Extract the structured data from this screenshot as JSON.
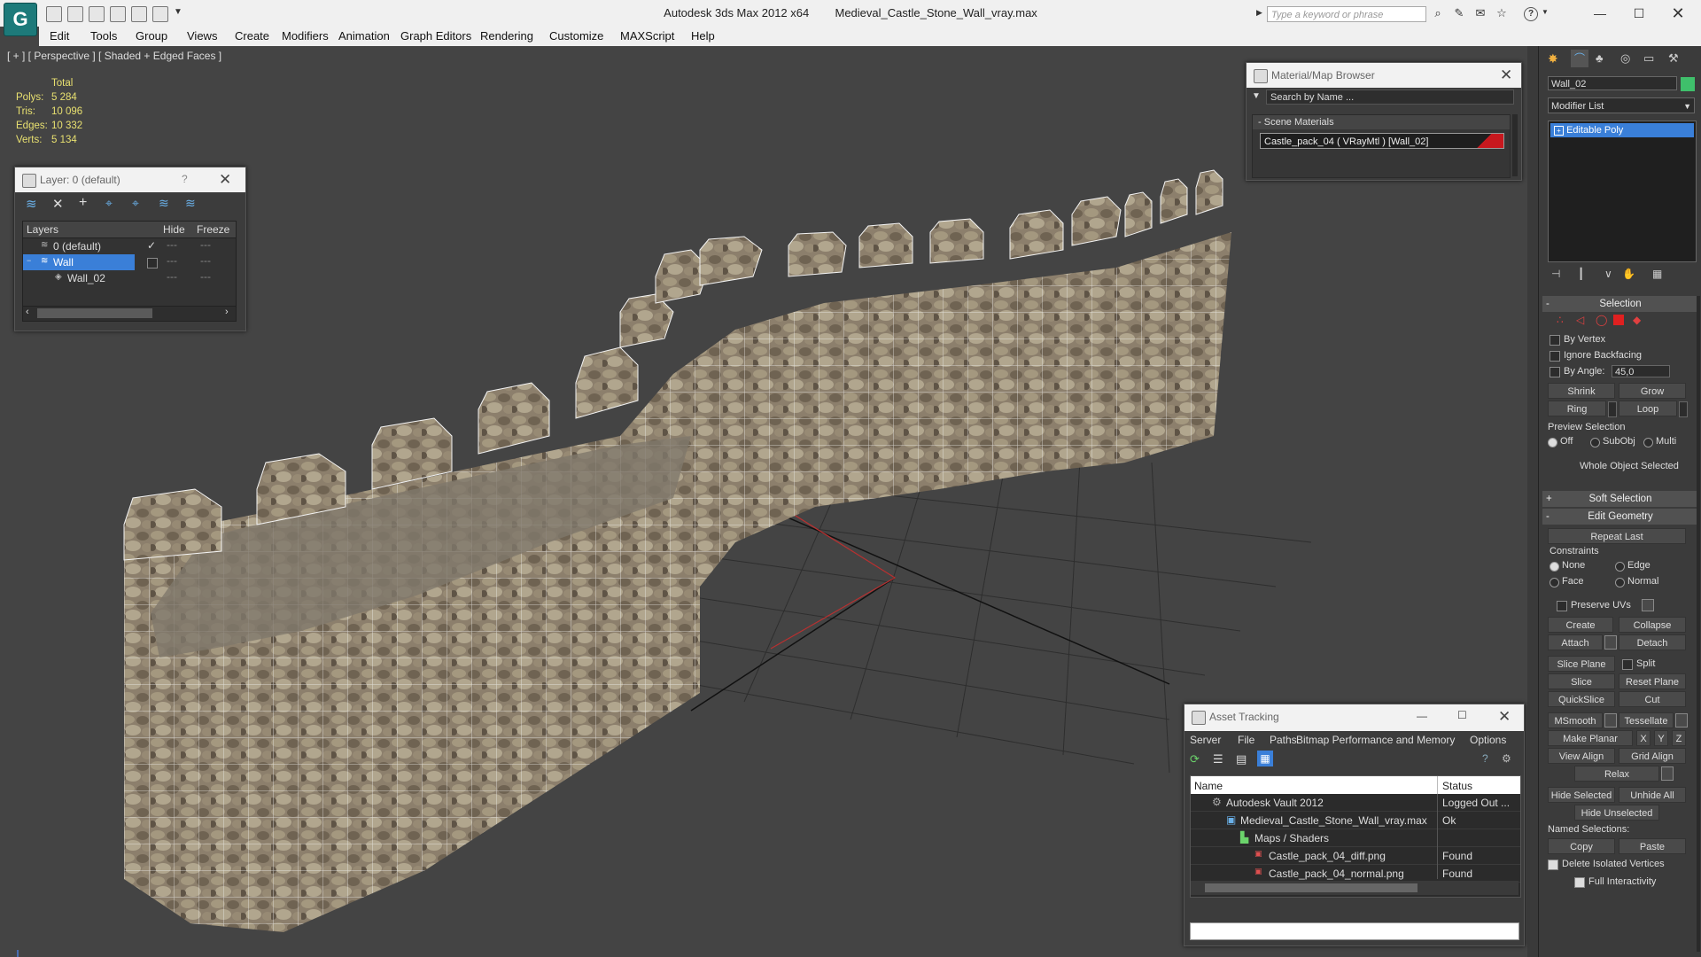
{
  "titlebar": {
    "app_title": "Autodesk 3ds Max  2012 x64",
    "file_name": "Medieval_Castle_Stone_Wall_vray.max",
    "search_placeholder": "Type a keyword or phrase",
    "app_icon": "3ds-max-logo-icon"
  },
  "menu": [
    "Edit",
    "Tools",
    "Group",
    "Views",
    "Create",
    "Modifiers",
    "Animation",
    "Graph Editors",
    "Rendering",
    "Customize",
    "MAXScript",
    "Help"
  ],
  "viewport": {
    "label": "[ + ] [ Perspective ] [ Shaded + Edged Faces ]",
    "stats": {
      "total_label": "Total",
      "rows": [
        {
          "label": "Polys:",
          "value": "5 284"
        },
        {
          "label": "Tris:",
          "value": "10 096"
        },
        {
          "label": "Edges:",
          "value": "10 332"
        },
        {
          "label": "Verts:",
          "value": "5 134"
        }
      ]
    }
  },
  "layer_window": {
    "title": "Layer: 0 (default)",
    "help": "?",
    "col_layers": "Layers",
    "col_hide": "Hide",
    "col_freeze": "Freeze",
    "rows": [
      {
        "name": "0 (default)"
      },
      {
        "name": "Wall"
      },
      {
        "name": "Wall_02"
      }
    ]
  },
  "material_browser": {
    "title": "Material/Map Browser",
    "search_placeholder": "Search by Name ...",
    "section": "Scene Materials",
    "material": "Castle_pack_04  ( VRayMtl )  [Wall_02]",
    "swatch_color": "#c8181e"
  },
  "asset_tracking": {
    "title": "Asset Tracking",
    "menu": [
      "Server",
      "File",
      "Paths",
      "Bitmap Performance and Memory",
      "Options"
    ],
    "col_name": "Name",
    "col_status": "Status",
    "rows": [
      {
        "name": "Autodesk Vault 2012",
        "status": "Logged Out ..."
      },
      {
        "name": "Medieval_Castle_Stone_Wall_vray.max",
        "status": "Ok"
      },
      {
        "name": "Maps / Shaders",
        "status": ""
      },
      {
        "name": "Castle_pack_04_diff.png",
        "status": "Found"
      },
      {
        "name": "Castle_pack_04_normal.png",
        "status": "Found"
      }
    ]
  },
  "command_panel": {
    "object_name": "Wall_02",
    "object_color": "#3fbf6b",
    "modifier_list": "Modifier List",
    "stack_item": "Editable Poly",
    "selection": {
      "head": "Selection",
      "by_vertex": "By Vertex",
      "ignore_backfacing": "Ignore Backfacing",
      "by_angle": "By Angle:",
      "angle_value": "45,0",
      "shrink": "Shrink",
      "grow": "Grow",
      "ring": "Ring",
      "loop": "Loop",
      "preview_label": "Preview Selection",
      "preview_off": "Off",
      "preview_subobj": "SubObj",
      "preview_multi": "Multi",
      "status": "Whole Object Selected"
    },
    "soft_selection": "Soft Selection",
    "edit_geometry": {
      "head": "Edit Geometry",
      "repeat_last": "Repeat Last",
      "constraints": "Constraints",
      "none": "None",
      "edge": "Edge",
      "face": "Face",
      "normal": "Normal",
      "preserve_uvs": "Preserve UVs",
      "create": "Create",
      "collapse": "Collapse",
      "attach": "Attach",
      "detach": "Detach",
      "slice_plane": "Slice Plane",
      "split": "Split",
      "slice": "Slice",
      "reset_plane": "Reset Plane",
      "quickslice": "QuickSlice",
      "cut": "Cut",
      "msmooth": "MSmooth",
      "tessellate": "Tessellate",
      "make_planar": "Make Planar",
      "x": "X",
      "y": "Y",
      "z": "Z",
      "view_align": "View Align",
      "grid_align": "Grid Align",
      "relax": "Relax",
      "hide_selected": "Hide Selected",
      "unhide_all": "Unhide All",
      "hide_unselected": "Hide Unselected",
      "named_selections": "Named Selections:",
      "copy": "Copy",
      "paste": "Paste",
      "delete_isolated": "Delete Isolated Vertices",
      "full_interactivity": "Full Interactivity"
    }
  }
}
